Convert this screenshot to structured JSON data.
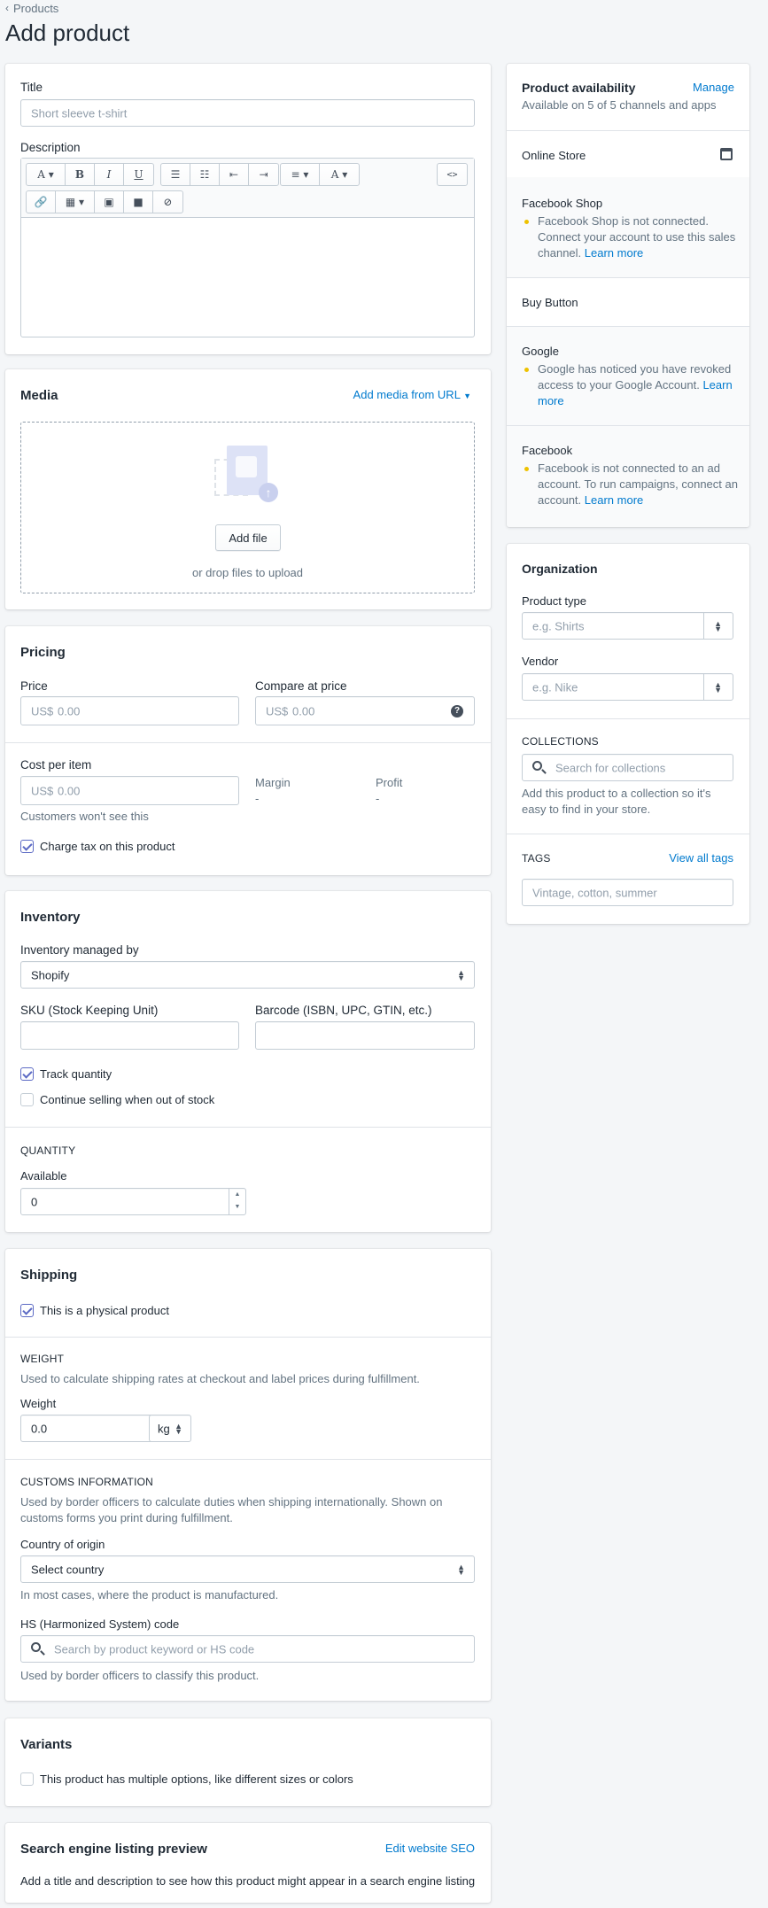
{
  "breadcrumb": {
    "label": "Products"
  },
  "page": {
    "title": "Add product"
  },
  "title_section": {
    "label": "Title",
    "placeholder": "Short sleeve t-shirt"
  },
  "description": {
    "label": "Description",
    "code_label": "<>"
  },
  "media": {
    "heading": "Media",
    "add_from_url": "Add media from URL",
    "add_file": "Add file",
    "drop_text": "or drop files to upload"
  },
  "pricing": {
    "heading": "Pricing",
    "price_label": "Price",
    "compare_label": "Compare at price",
    "currency": "US$",
    "price_placeholder": "0.00",
    "compare_placeholder": "0.00",
    "cost_label": "Cost per item",
    "cost_placeholder": "0.00",
    "cost_help": "Customers won't see this",
    "margin_label": "Margin",
    "margin_value": "-",
    "profit_label": "Profit",
    "profit_value": "-",
    "charge_tax": "Charge tax on this product"
  },
  "inventory": {
    "heading": "Inventory",
    "managed_by_label": "Inventory managed by",
    "managed_by_value": "Shopify",
    "sku_label": "SKU (Stock Keeping Unit)",
    "barcode_label": "Barcode (ISBN, UPC, GTIN, etc.)",
    "track_quantity": "Track quantity",
    "continue_selling": "Continue selling when out of stock",
    "quantity_heading": "QUANTITY",
    "available_label": "Available",
    "available_value": "0"
  },
  "shipping": {
    "heading": "Shipping",
    "physical": "This is a physical product",
    "weight_heading": "WEIGHT",
    "weight_help": "Used to calculate shipping rates at checkout and label prices during fulfillment.",
    "weight_label": "Weight",
    "weight_value": "0.0",
    "weight_unit": "kg",
    "customs_heading": "CUSTOMS INFORMATION",
    "customs_help_1": "Used by border officers to calculate duties when shipping internationally. Shown on",
    "customs_help_2": "customs forms you print during fulfillment.",
    "country_label": "Country of origin",
    "country_value": "Select country",
    "country_help": "In most cases, where the product is manufactured.",
    "hs_label": "HS (Harmonized System) code",
    "hs_placeholder": "Search by product keyword or HS code",
    "hs_help": "Used by border officers to classify this product."
  },
  "variants": {
    "heading": "Variants",
    "multiple": "This product has multiple options, like different sizes or colors"
  },
  "seo": {
    "heading": "Search engine listing preview",
    "edit_link": "Edit website SEO",
    "help": "Add a title and description to see how this product might appear in a search engine listing"
  },
  "availability": {
    "heading": "Product availability",
    "manage": "Manage",
    "summary": "Available on 5 of 5 channels and apps",
    "online_store": "Online Store",
    "facebook_shop": "Facebook Shop",
    "facebook_shop_msg_1": "Facebook Shop is not connected.",
    "facebook_shop_msg_2": "Connect your account to use this sales",
    "facebook_shop_msg_3": "channel.",
    "learn_more": "Learn more",
    "buy_button": "Buy Button",
    "google": "Google",
    "google_msg_1": "Google has noticed you have revoked",
    "google_msg_2": "access to your Google Account.",
    "google_learn_1": "Learn",
    "google_learn_2": "more",
    "facebook": "Facebook",
    "facebook_msg_1": "Facebook is not connected to an ad",
    "facebook_msg_2": "account. To run campaigns, connect an",
    "facebook_msg_3": "account."
  },
  "organization": {
    "heading": "Organization",
    "product_type_label": "Product type",
    "product_type_placeholder": "e.g. Shirts",
    "vendor_label": "Vendor",
    "vendor_placeholder": "e.g. Nike",
    "collections_heading": "COLLECTIONS",
    "collections_placeholder": "Search for collections",
    "collections_help_1": "Add this product to a collection so it's",
    "collections_help_2": "easy to find in your store.",
    "tags_heading": "TAGS",
    "view_all_tags": "View all tags",
    "tags_placeholder": "Vintage, cotton, summer"
  }
}
